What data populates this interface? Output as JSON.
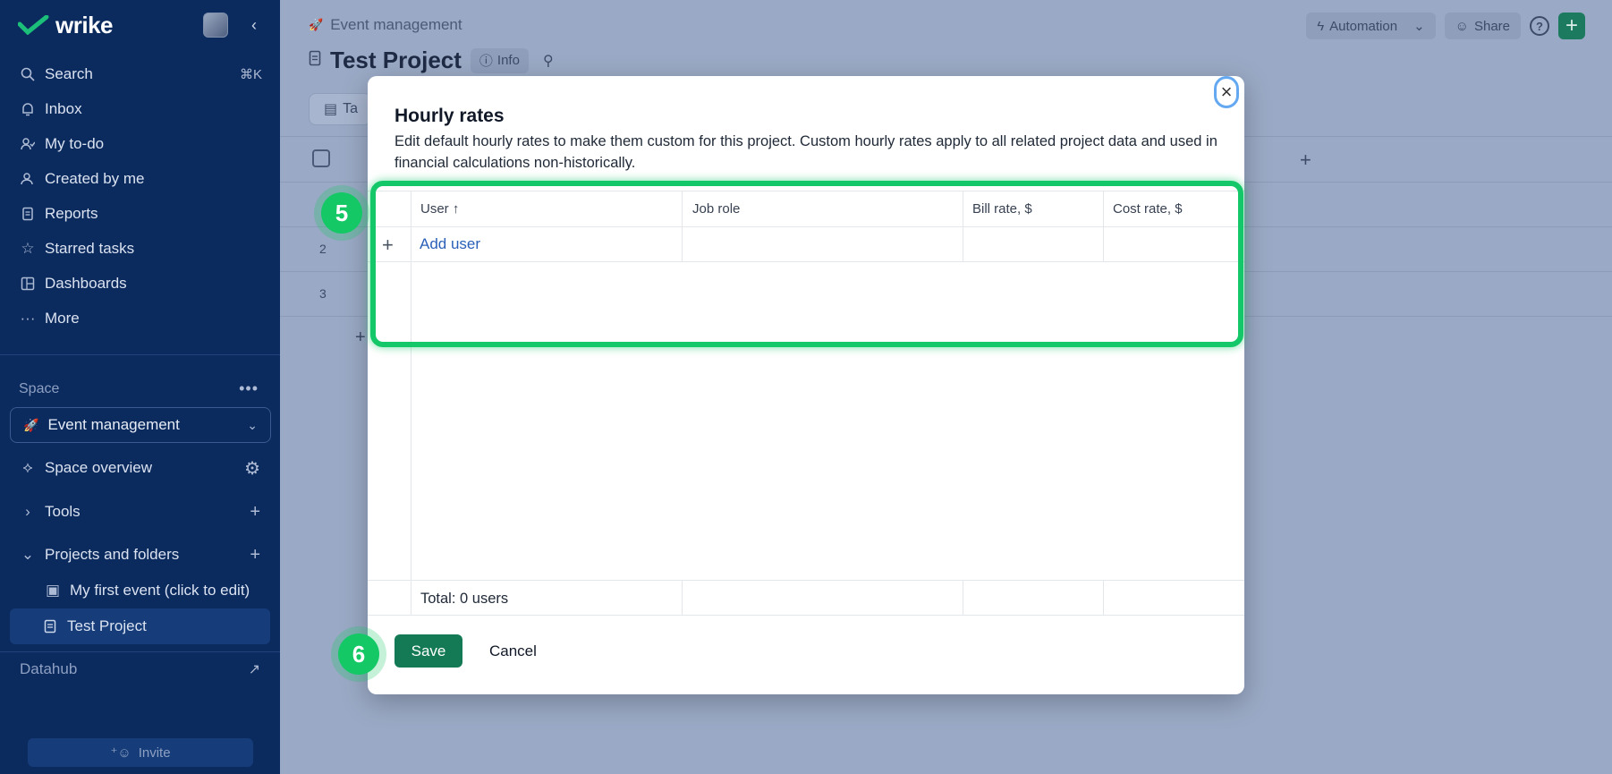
{
  "sidebar": {
    "brand": "wrike",
    "nav": [
      {
        "label": "Search",
        "icon": "search-icon",
        "shortcut": "⌘K"
      },
      {
        "label": "Inbox",
        "icon": "bell-icon"
      },
      {
        "label": "My to-do",
        "icon": "person-check-icon"
      },
      {
        "label": "Created by me",
        "icon": "person-icon"
      },
      {
        "label": "Reports",
        "icon": "report-icon"
      },
      {
        "label": "Starred tasks",
        "icon": "star-icon"
      },
      {
        "label": "Dashboards",
        "icon": "dashboard-icon"
      },
      {
        "label": "More",
        "icon": "more-icon"
      }
    ],
    "space_label": "Space",
    "space_name": "Event management",
    "space_overview": "Space overview",
    "tools": "Tools",
    "projects_and_folders": "Projects and folders",
    "project_items": [
      "My first event (click to edit)",
      "Test Project"
    ],
    "datahub": "Datahub",
    "invite": "Invite"
  },
  "main": {
    "breadcrumb": "Event management",
    "automation": "Automation",
    "share": "Share",
    "title": "Test Project",
    "info": "Info",
    "view_tab": "Ta",
    "row_numbers": [
      "1",
      "2",
      "3"
    ]
  },
  "modal": {
    "title": "Hourly rates",
    "description": "Edit default hourly rates to make them custom for this project. Custom hourly rates apply to all related project data and used in financial calculations non-historically.",
    "columns": [
      "User ↑",
      "Job role",
      "Bill rate, $",
      "Cost rate, $"
    ],
    "add_user": "Add user",
    "total": "Total: 0 users",
    "save": "Save",
    "cancel": "Cancel"
  },
  "annotations": {
    "step5": "5",
    "step6": "6"
  },
  "colors": {
    "highlight": "#14c768",
    "save": "#137a55",
    "link": "#2a5fb8"
  }
}
